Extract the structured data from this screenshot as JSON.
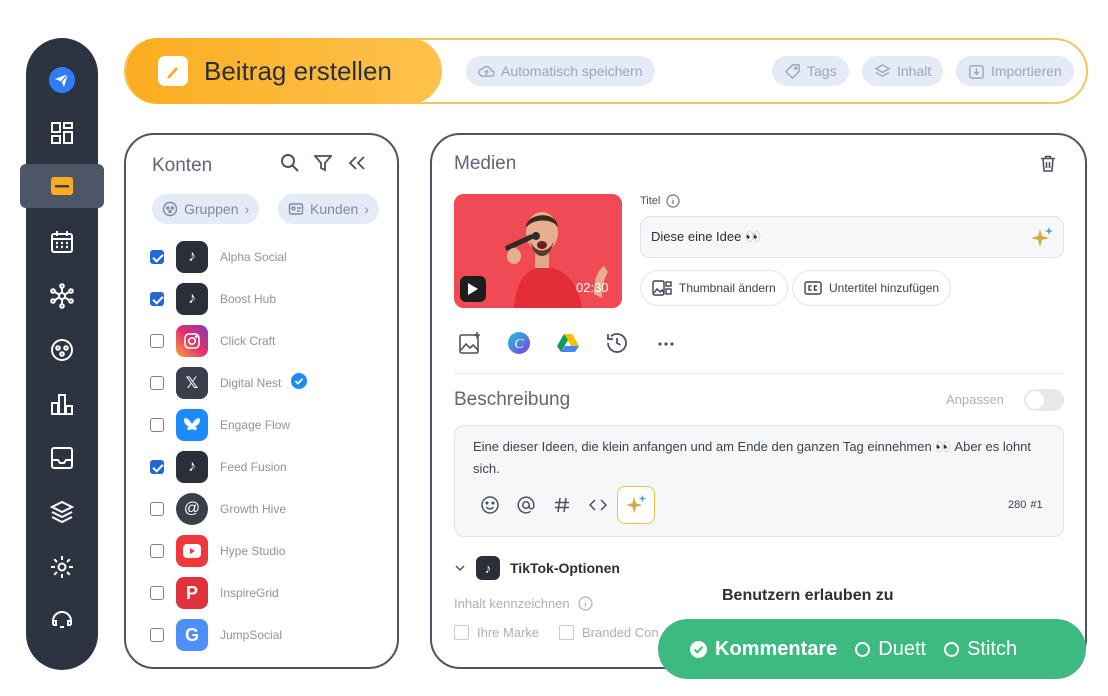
{
  "header": {
    "title": "Beitrag erstellen",
    "autosave": "Automatisch speichern",
    "tags": "Tags",
    "content": "Inhalt",
    "import": "Importieren"
  },
  "sidebar": {
    "items": [
      {
        "icon": "send-logo-icon"
      },
      {
        "icon": "dashboard-icon"
      },
      {
        "icon": "compose-icon",
        "active": true
      },
      {
        "icon": "calendar-icon"
      },
      {
        "icon": "network-icon"
      },
      {
        "icon": "groups-icon"
      },
      {
        "icon": "analytics-icon"
      },
      {
        "icon": "inbox-icon"
      },
      {
        "icon": "layers-icon"
      },
      {
        "icon": "settings-icon"
      },
      {
        "icon": "support-icon"
      }
    ]
  },
  "accounts": {
    "title": "Konten",
    "groups_label": "Gruppen",
    "customers_label": "Kunden",
    "list": [
      {
        "name": "Alpha Social",
        "platform": "tiktok",
        "checked": true
      },
      {
        "name": "Boost Hub",
        "platform": "tiktok",
        "checked": true
      },
      {
        "name": "Click Craft",
        "platform": "instagram",
        "checked": false
      },
      {
        "name": "Digital Nest",
        "platform": "x",
        "checked": false,
        "verified": true
      },
      {
        "name": "Engage Flow",
        "platform": "bluesky",
        "checked": false
      },
      {
        "name": "Feed Fusion",
        "platform": "tiktok",
        "checked": true
      },
      {
        "name": "Growth Hive",
        "platform": "threads",
        "checked": false
      },
      {
        "name": "Hype Studio",
        "platform": "youtube",
        "checked": false
      },
      {
        "name": "InspireGrid",
        "platform": "pinterest",
        "checked": false
      },
      {
        "name": "JumpSocial",
        "platform": "google",
        "checked": false
      }
    ]
  },
  "media": {
    "title": "Medien",
    "video_duration": "02:30",
    "title_label": "Titel",
    "title_value": "Diese eine Idee 👀",
    "change_thumbnail": "Thumbnail ändern",
    "add_subtitles": "Untertitel hinzufügen"
  },
  "description": {
    "title": "Beschreibung",
    "customize_label": "Anpassen",
    "customize_on": false,
    "text": "Eine dieser Ideen, die klein anfangen und am Ende den ganzen Tag einnehmen 👀 Aber es lohnt sich.",
    "char_count": "280",
    "post_index": "#1"
  },
  "tiktok": {
    "section_title": "TikTok-Optionen",
    "label_content": "Inhalt kennzeichnen",
    "own_brand": "Ihre Marke",
    "branded_content": "Branded Con",
    "allow_users_title": "Benutzern erlauben zu",
    "comments": "Kommentare",
    "duet": "Duett",
    "stitch": "Stitch",
    "comments_on": true,
    "duet_on": false,
    "stitch_on": false
  },
  "colors": {
    "accent_orange": "#fbad1f",
    "sidebar_bg": "#2c3442",
    "pill_bg": "#e4eaf6",
    "green": "#3dba7f",
    "check_blue": "#2667d8"
  }
}
